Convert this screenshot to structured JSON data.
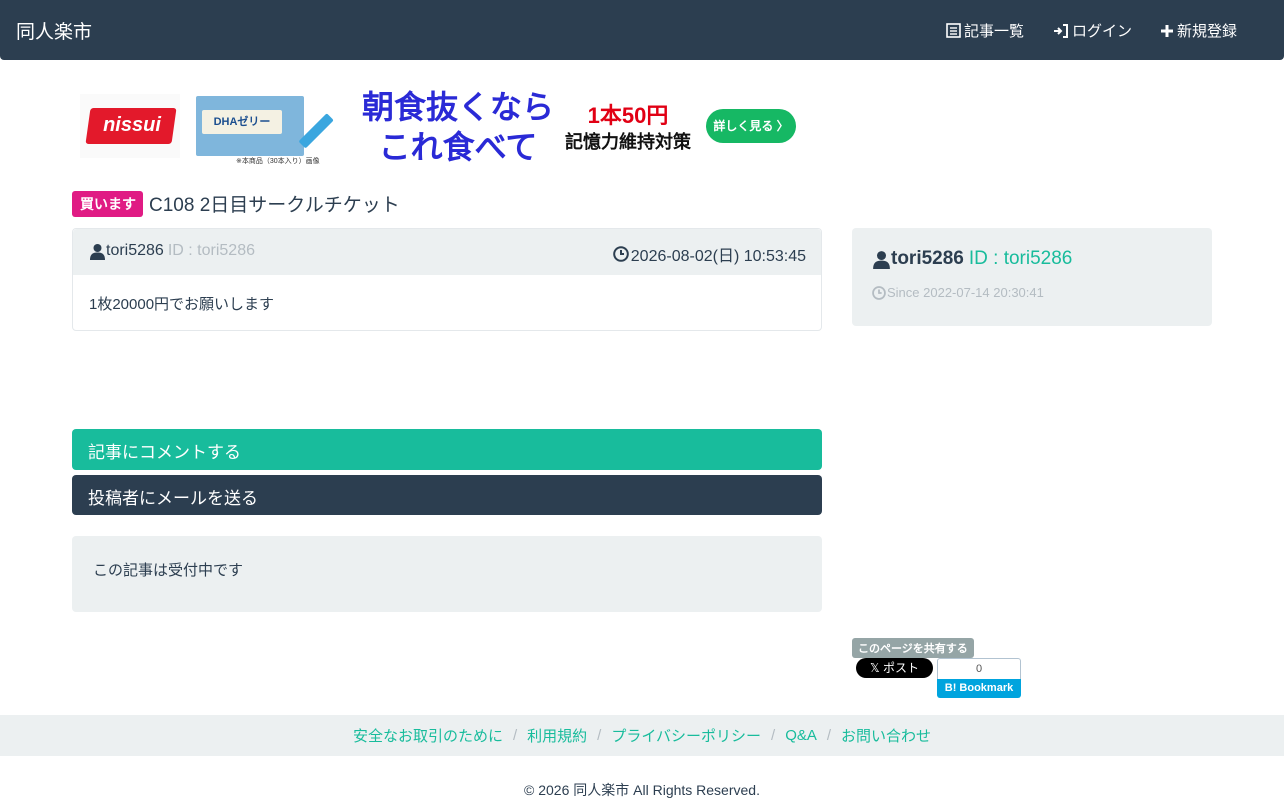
{
  "nav": {
    "brand": "同人楽市",
    "articles": "記事一覧",
    "login": "ログイン",
    "register": "新規登録"
  },
  "banner": {
    "logo": "nissui",
    "product_label": "DHAゼリー",
    "product_note": "※本商品（30本入り）画像",
    "headline_1": "朝食抜くなら",
    "headline_2": "これ食べて",
    "price": "1本50円",
    "subtitle": "記憶力維持対策",
    "button": "詳しく見る 〉"
  },
  "post": {
    "badge": "買います",
    "title": "C108 2日目サークルチケット",
    "author": "tori5286",
    "author_id": "ID : tori5286",
    "date": "2026-08-02(日) 10:53:45",
    "body": "1枚20000円でお願いします"
  },
  "actions": {
    "comment": "記事にコメントする",
    "mail": "投稿者にメールを送る"
  },
  "status": {
    "text": "この記事は受付中です"
  },
  "user_card": {
    "name": "tori5286",
    "id": "ID : tori5286",
    "since": "Since 2022-07-14 20:30:41"
  },
  "share": {
    "label": "このページを共有する",
    "x_post": "𝕏 ポスト",
    "hatena_count": "0",
    "hatena_label": "B! Bookmark"
  },
  "footer": {
    "links": [
      "安全なお取引のために",
      "利用規約",
      "プライバシーポリシー",
      "Q&A",
      "お問い合わせ"
    ],
    "copyright": "© 2026 同人楽市 All Rights Reserved."
  },
  "colors": {
    "navbar": "#2c3e50",
    "accent": "#18bc9c",
    "badge": "#e01b84",
    "panel": "#ecf0f1"
  }
}
